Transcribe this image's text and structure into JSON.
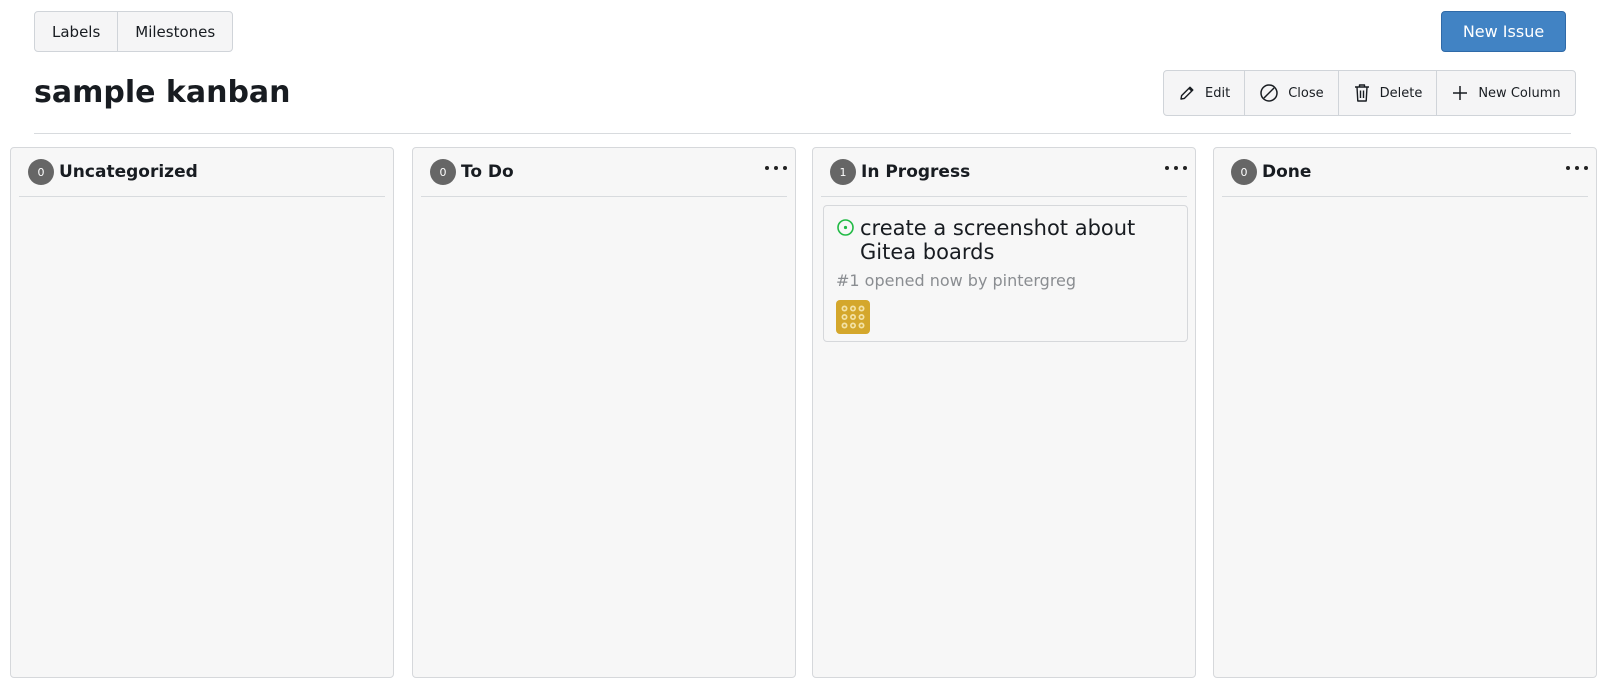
{
  "top_tabs": [
    {
      "label": "Labels"
    },
    {
      "label": "Milestones"
    }
  ],
  "new_issue_label": "New Issue",
  "project_title": "sample kanban",
  "actions": {
    "edit_label": "Edit",
    "close_label": "Close",
    "delete_label": "Delete",
    "new_column_label": "New Column"
  },
  "colors": {
    "accent": "#4183c4",
    "open_issue": "#21ba45",
    "avatar": "#d4a72c"
  },
  "columns": [
    {
      "title": "Uncategorized",
      "count": "0"
    },
    {
      "title": "To Do",
      "count": "0"
    },
    {
      "title": "In Progress",
      "count": "1",
      "cards": [
        {
          "title": "create a screenshot about Gitea boards",
          "meta": "#1 opened now by pintergreg",
          "icon": "issue-opened-icon"
        }
      ]
    },
    {
      "title": "Done",
      "count": "0"
    }
  ]
}
